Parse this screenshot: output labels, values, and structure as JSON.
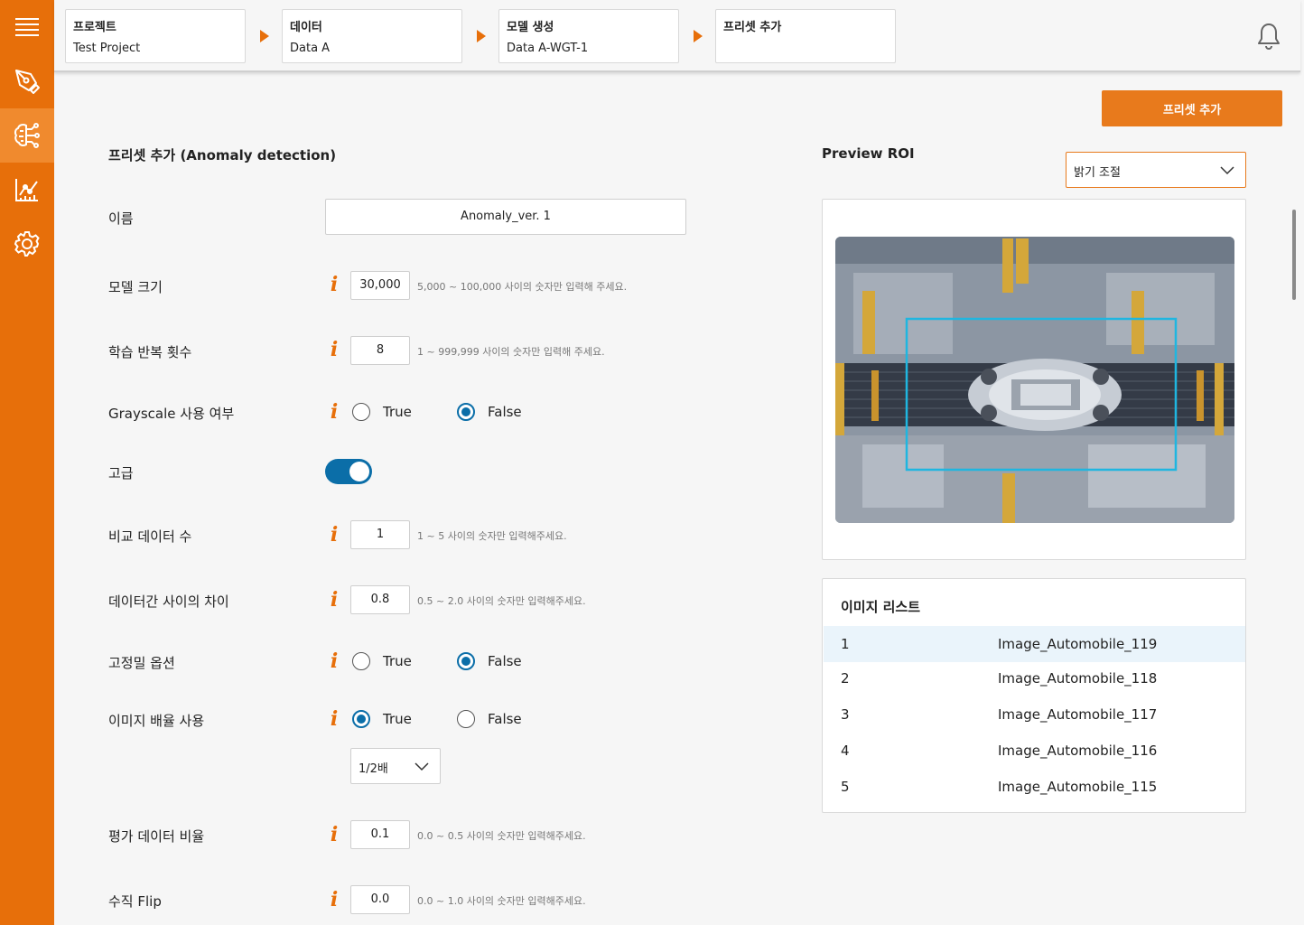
{
  "breadcrumb": [
    {
      "title": "프로젝트",
      "value": "Test Project"
    },
    {
      "title": "데이터",
      "value": "Data A"
    },
    {
      "title": "모델 생성",
      "value": "Data A-WGT-1"
    },
    {
      "title": "프리셋 추가",
      "value": ""
    }
  ],
  "sidebar": {
    "items": [
      {
        "icon": "menu-icon"
      },
      {
        "icon": "pen-tool-icon"
      },
      {
        "icon": "brain-network-icon",
        "active": true
      },
      {
        "icon": "chart-icon"
      },
      {
        "icon": "gear-icon"
      }
    ]
  },
  "colors": {
    "brand": "#e76f0a",
    "accent": "#0b6ea8",
    "roi": "#1fb6e0"
  },
  "add_button": "프리셋 추가",
  "form": {
    "title": "프리셋 추가 (Anomaly detection)",
    "name": {
      "label": "이름",
      "value": "Anomaly_ver. 1"
    },
    "model_size": {
      "label": "모델 크기",
      "value": "30,000",
      "hint": "5,000 ~ 100,000 사이의 숫자만 입력해 주세요."
    },
    "iterations": {
      "label": "학습 반복 횟수",
      "value": "8",
      "hint": "1 ~ 999,999 사이의 숫자만 입력해 주세요."
    },
    "grayscale": {
      "label": "Grayscale 사용 여부",
      "true_label": "True",
      "false_label": "False",
      "selected": "False"
    },
    "advanced": {
      "label": "고급",
      "enabled": true
    },
    "compare_count": {
      "label": "비교 데이터 수",
      "value": "1",
      "hint": "1 ~ 5 사이의 숫자만 입력해주세요."
    },
    "data_gap": {
      "label": "데이터간 사이의 차이",
      "value": "0.8",
      "hint": "0.5 ~ 2.0 사이의 숫자만 입력해주세요."
    },
    "high_precision": {
      "label": "고정밀 옵션",
      "true_label": "True",
      "false_label": "False",
      "selected": "False"
    },
    "image_scale": {
      "label": "이미지 배율 사용",
      "true_label": "True",
      "false_label": "False",
      "selected": "True",
      "scale_value": "1/2배"
    },
    "eval_ratio": {
      "label": "평가 데이터 비율",
      "value": "0.1",
      "hint": "0.0 ~ 0.5 사이의 숫자만 입력해주세요."
    },
    "vertical_flip": {
      "label": "수직 Flip",
      "value": "0.0",
      "hint": "0.0 ~ 1.0 사이의 숫자만 입력해주세요."
    }
  },
  "preview": {
    "title": "Preview ROI",
    "brightness_select": "밝기 조절"
  },
  "image_list": {
    "title": "이미지 리스트",
    "rows": [
      {
        "index": "1",
        "name": "Image_Automobile_119"
      },
      {
        "index": "2",
        "name": "Image_Automobile_118"
      },
      {
        "index": "3",
        "name": "Image_Automobile_117"
      },
      {
        "index": "4",
        "name": "Image_Automobile_116"
      },
      {
        "index": "5",
        "name": "Image_Automobile_115"
      }
    ]
  }
}
